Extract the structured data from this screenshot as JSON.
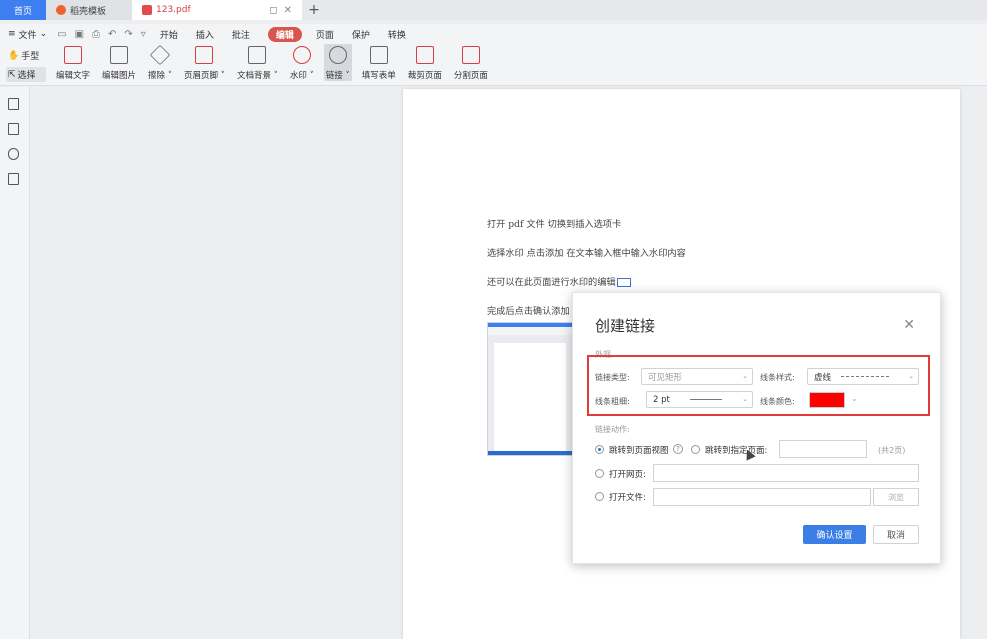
{
  "tabs": {
    "home": "首页",
    "templates": "稻壳模板",
    "file": "123.pdf",
    "add": "+"
  },
  "menu": {
    "file": "文件",
    "items": [
      "开始",
      "插入",
      "批注",
      "编辑",
      "页面",
      "保护",
      "转换"
    ],
    "active": "编辑"
  },
  "ribbon": {
    "hand": "手型",
    "select": "选择",
    "tools": [
      {
        "label": "编辑文字",
        "icon": "edit-text-icon"
      },
      {
        "label": "编辑图片",
        "icon": "edit-image-icon"
      },
      {
        "label": "擦除 ˅",
        "icon": "eraser-icon"
      },
      {
        "label": "页眉页脚 ˅",
        "icon": "header-footer-icon"
      },
      {
        "label": "文档背景 ˅",
        "icon": "background-icon"
      },
      {
        "label": "水印 ˅",
        "icon": "watermark-icon"
      },
      {
        "label": "链接 ˅",
        "icon": "link-icon"
      },
      {
        "label": "填写表单",
        "icon": "form-icon"
      },
      {
        "label": "裁剪页面",
        "icon": "crop-icon"
      },
      {
        "label": "分割页面",
        "icon": "split-icon"
      }
    ]
  },
  "page": {
    "line1": "打开 pdf 文件   切换到插入选项卡",
    "line2": "选择水印     点击添加   在文本输入框中输入水印内容",
    "line3": "还可以在此页面进行水印的编辑",
    "line4": "完成后点击确认添加"
  },
  "dialog": {
    "title": "创建链接",
    "appearance_label": "外观",
    "link_type_label": "链接类型:",
    "link_type_value": "可见矩形",
    "line_style_label": "线条样式:",
    "line_style_value": "虚线",
    "line_width_label": "线条粗细:",
    "line_width_value": "2 pt",
    "line_color_label": "线条颜色:",
    "line_color": "#ff0000",
    "action_label": "链接动作:",
    "goto_view": "跳转到页面视图",
    "goto_page": "跳转到指定页面:",
    "total_pages": "(共2页)",
    "open_web": "打开网页:",
    "open_file": "打开文件:",
    "browse": "浏览",
    "confirm": "确认设置",
    "cancel": "取消"
  }
}
